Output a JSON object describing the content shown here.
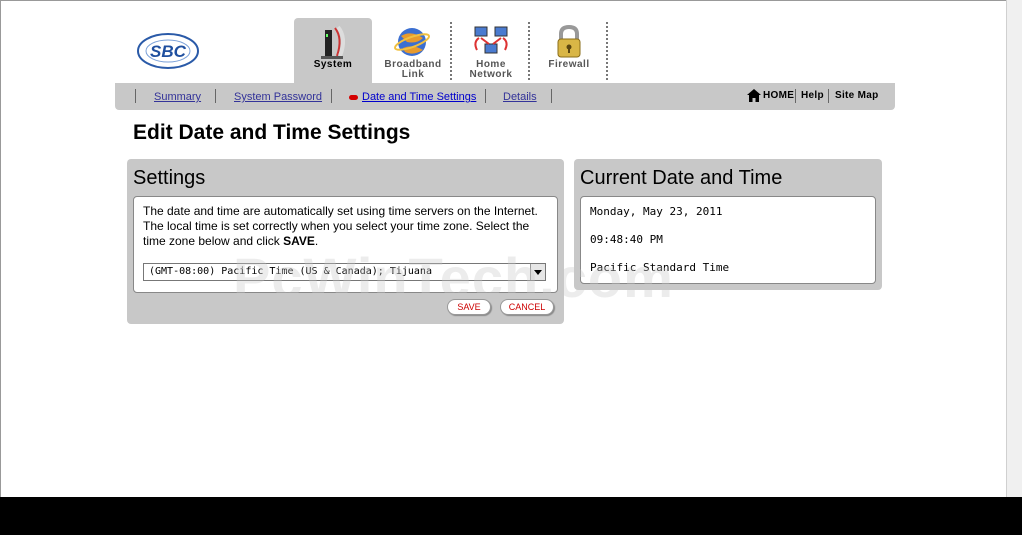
{
  "brand": {
    "logo_text": "SBC"
  },
  "tabs": [
    {
      "label_line1": "System",
      "label_line2": "",
      "icon": "modem-icon",
      "active": true
    },
    {
      "label_line1": "Broadband",
      "label_line2": "Link",
      "icon": "globe-icon",
      "active": false
    },
    {
      "label_line1": "Home",
      "label_line2": "Network",
      "icon": "network-icon",
      "active": false
    },
    {
      "label_line1": "Firewall",
      "label_line2": "",
      "icon": "padlock-icon",
      "active": false
    }
  ],
  "subnav": {
    "items": [
      "Summary",
      "System Password",
      "Date and Time Settings",
      "Details"
    ],
    "right": {
      "home": "HOME",
      "help": "Help",
      "sitemap": "Site Map"
    }
  },
  "page_title": "Edit Date and Time Settings",
  "settings": {
    "heading": "Settings",
    "description_part1": "The date and time are automatically set using time servers on the Internet. The local time is set correctly when you select your time zone. Select the time zone below and click ",
    "description_bold": "SAVE",
    "description_end": ".",
    "timezone_selected": "(GMT-08:00) Pacific Time (US & Canada); Tijuana",
    "save_label": "SAVE",
    "cancel_label": "CANCEL"
  },
  "current": {
    "heading": "Current Date and Time",
    "date": "Monday, May 23, 2011",
    "time": "09:48:40 PM",
    "zone": "Pacific Standard Time"
  },
  "watermark": "PcWinTech.com",
  "colors": {
    "panel": "#c8c8c8",
    "link": "#333399",
    "accent_red": "#d40000"
  }
}
